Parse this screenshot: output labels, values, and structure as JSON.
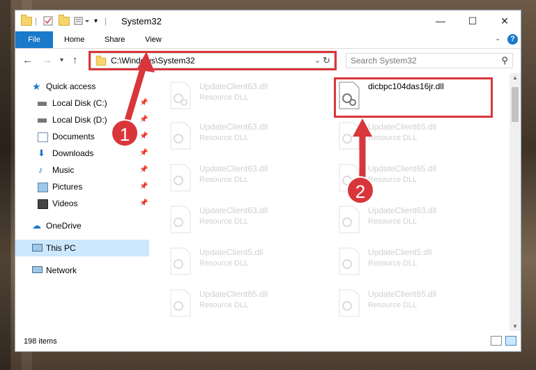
{
  "window": {
    "title": "System32",
    "controls": {
      "minimize": "—",
      "maximize": "☐",
      "close": "✕"
    }
  },
  "ribbon": {
    "tabs": [
      "File",
      "Home",
      "Share",
      "View"
    ],
    "help_icon": "help-icon"
  },
  "address": {
    "path": "C:\\Windows\\System32",
    "search_placeholder": "Search System32"
  },
  "nav_pane": {
    "items": [
      {
        "label": "Quick access",
        "icon": "star-icon"
      },
      {
        "label": "Local Disk (C:)",
        "icon": "drive-icon"
      },
      {
        "label": "Local Disk (D:)",
        "icon": "drive-icon"
      },
      {
        "label": "Documents",
        "icon": "documents-icon"
      },
      {
        "label": "Downloads",
        "icon": "downloads-icon"
      },
      {
        "label": "Music",
        "icon": "music-icon"
      },
      {
        "label": "Pictures",
        "icon": "pictures-icon"
      },
      {
        "label": "Videos",
        "icon": "videos-icon"
      },
      {
        "label": "OneDrive",
        "icon": "cloud-icon"
      },
      {
        "label": "This PC",
        "icon": "computer-icon"
      },
      {
        "label": "Network",
        "icon": "network-icon"
      }
    ]
  },
  "files": [
    {
      "name": "UpdateClient63.dll",
      "type": "Resource DLL"
    },
    {
      "name": "dicbpc104das16jr.dll",
      "type": ""
    },
    {
      "name": "UpdateClient63.dll",
      "type": "Resource DLL"
    },
    {
      "name": "UpdateClient65.dll",
      "type": "Resource DLL"
    },
    {
      "name": "UpdateClient63.dll",
      "type": "Resource DLL"
    },
    {
      "name": "UpdateClient65.dll",
      "type": "Resource DLL"
    },
    {
      "name": "UpdateClient63.dll",
      "type": "Resource DLL"
    },
    {
      "name": "UpdateClient63.dll",
      "type": "Resource DLL"
    },
    {
      "name": "UpdateClient5.dll",
      "type": "Resource DLL"
    },
    {
      "name": "UpdateClient5.dll",
      "type": "Resource DLL"
    },
    {
      "name": "UpdateClient65.dll",
      "type": "Resource DLL"
    },
    {
      "name": "UpdateClient65.dll",
      "type": "Resource DLL"
    }
  ],
  "status": {
    "item_count": "198 items"
  },
  "callouts": [
    "1",
    "2"
  ],
  "colors": {
    "accent": "#1979ca",
    "highlight": "#d9363b",
    "selection": "#cce8ff"
  }
}
